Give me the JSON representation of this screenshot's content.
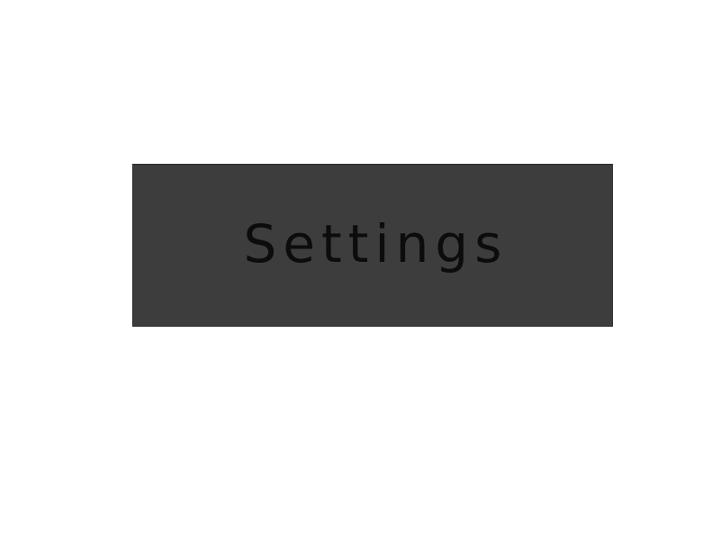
{
  "settings_button": {
    "label": "Settings"
  },
  "colors": {
    "page_background": "#ffffff",
    "button_background": "#3d3d3d",
    "button_text": "#0c0c0c"
  }
}
